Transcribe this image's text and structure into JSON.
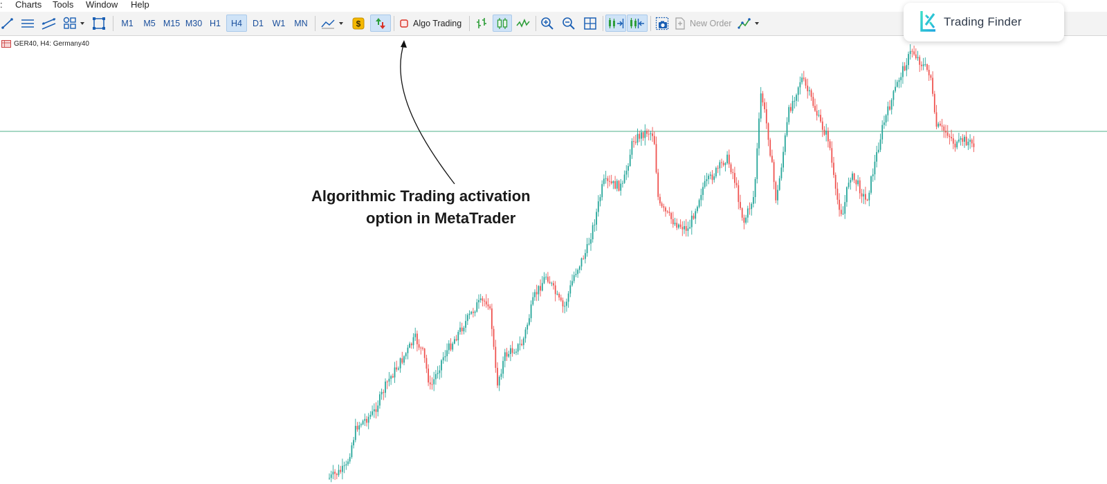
{
  "menu": {
    "items": [
      "Charts",
      "Tools",
      "Window",
      "Help"
    ]
  },
  "toolbar": {
    "drawing_icons": [
      "trendline-icon",
      "hlines-icon",
      "channel-icon",
      "shapes-icon",
      "rectangle-icon"
    ],
    "timeframes": [
      "M1",
      "M5",
      "M15",
      "M30",
      "H1",
      "H4",
      "D1",
      "W1",
      "MN"
    ],
    "active_timeframe": "H4",
    "algo_trading_label": "Algo Trading",
    "new_order_label": "New Order"
  },
  "chart": {
    "symbol_label": "GER40, H4:  Germany40",
    "bull_color": "#26a69a",
    "bear_color": "#ef5350",
    "level_line_color": "#4caf8a"
  },
  "annotation": {
    "line1": "Algorithmic Trading activation",
    "line2": "option in MetaTrader"
  },
  "logo": {
    "text": "Trading Finder"
  }
}
